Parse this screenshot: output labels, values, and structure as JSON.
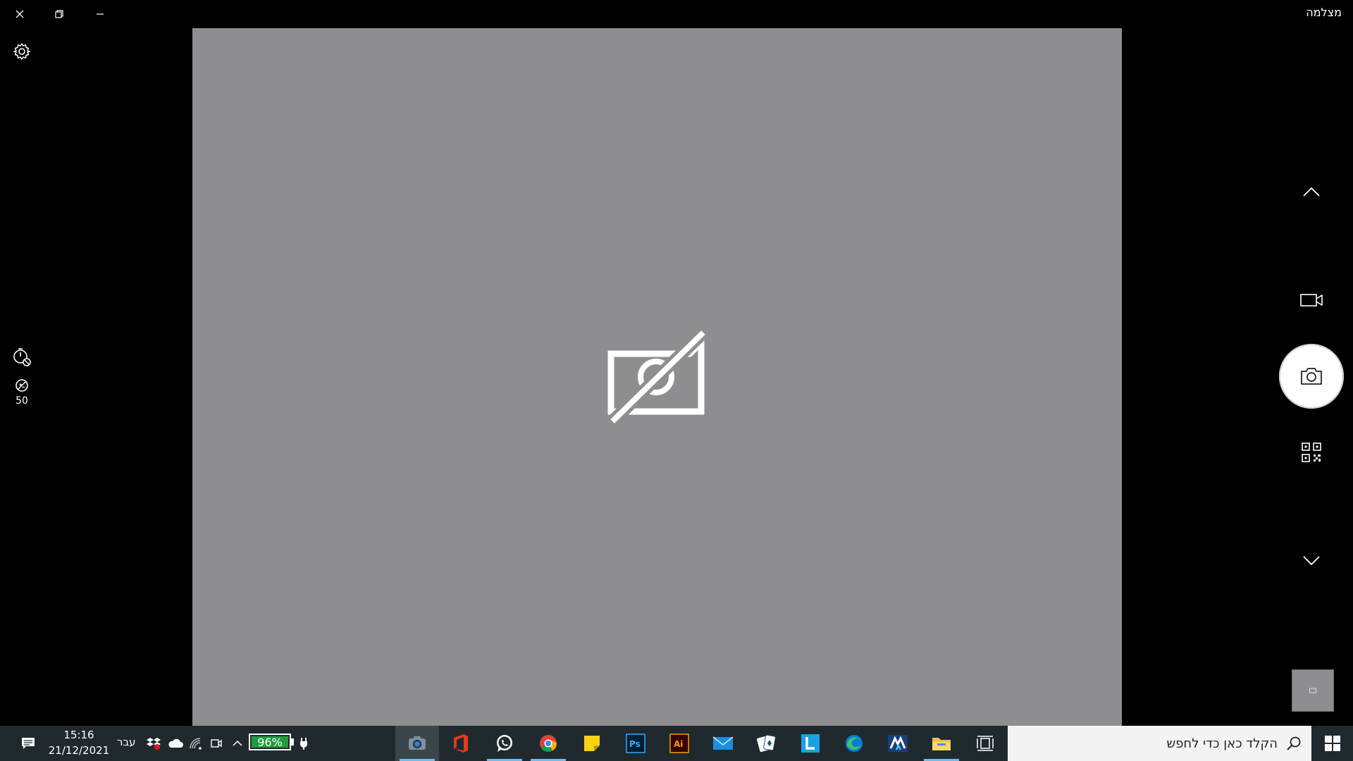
{
  "window": {
    "title": "מצלמה",
    "buttons": [
      "close-icon",
      "restore-icon",
      "minimize-icon"
    ]
  },
  "preview": {
    "background": "#8e8e90",
    "status_icon": "camera-off-icon"
  },
  "left_rail": {
    "settings_icon": "gear-icon",
    "timer_icon": "timer-off-icon",
    "brightness_icon": "brightness-icon",
    "brightness_value": "50"
  },
  "right_rail": {
    "scroll_up_icon": "chevron-up-icon",
    "video_mode_icon": "video-icon",
    "capture_icon": "camera-icon",
    "barcode_mode_icon": "qr-code-icon",
    "scroll_down_icon": "chevron-down-icon",
    "last_photo_thumbnail": "thumbnail"
  },
  "taskbar": {
    "time": "15:16",
    "date": "21/12/2021",
    "language": "עבר",
    "battery_percent": "96%",
    "battery_color": "#1e9b3a",
    "accent": "#76b9ed",
    "search_placeholder": "הקלד כאן כדי לחפש",
    "apps": [
      "camera-app",
      "office-app",
      "whatsapp-app",
      "chrome-app",
      "sticky-notes-app",
      "photoshop-app",
      "illustrator-app",
      "mail-app",
      "solitaire-app",
      "lingo-app",
      "edge-app",
      "m-app",
      "file-explorer-app",
      "task-view"
    ]
  }
}
